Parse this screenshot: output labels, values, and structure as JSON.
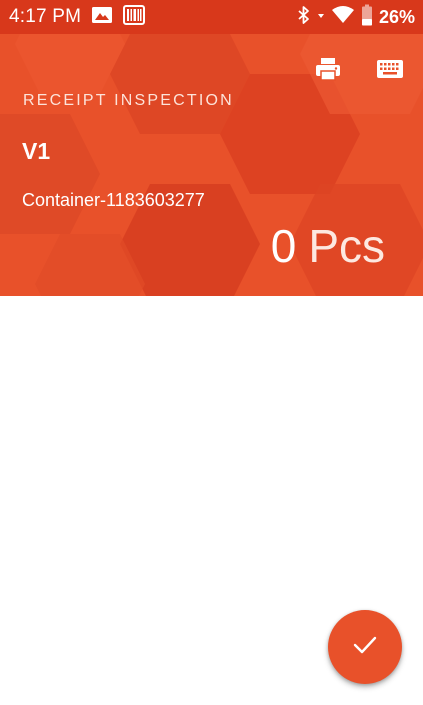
{
  "status_bar": {
    "time": "4:17 PM",
    "battery_percent": "26%",
    "icons": [
      "image-icon",
      "barcode-icon",
      "bluetooth-icon",
      "signal-arrows-icon",
      "wifi-icon",
      "battery-icon"
    ]
  },
  "header": {
    "module_title": "RECEIPT INSPECTION",
    "version": "V1",
    "container_id": "Container-1183603277",
    "count_value": "0",
    "count_unit": "Pcs",
    "actions": [
      "print-icon",
      "keyboard-icon"
    ]
  },
  "fab": {
    "icon": "checkmark-icon"
  },
  "colors": {
    "status_bar": "#d8381b",
    "header": "#e8512a",
    "fab": "#e8512a"
  }
}
